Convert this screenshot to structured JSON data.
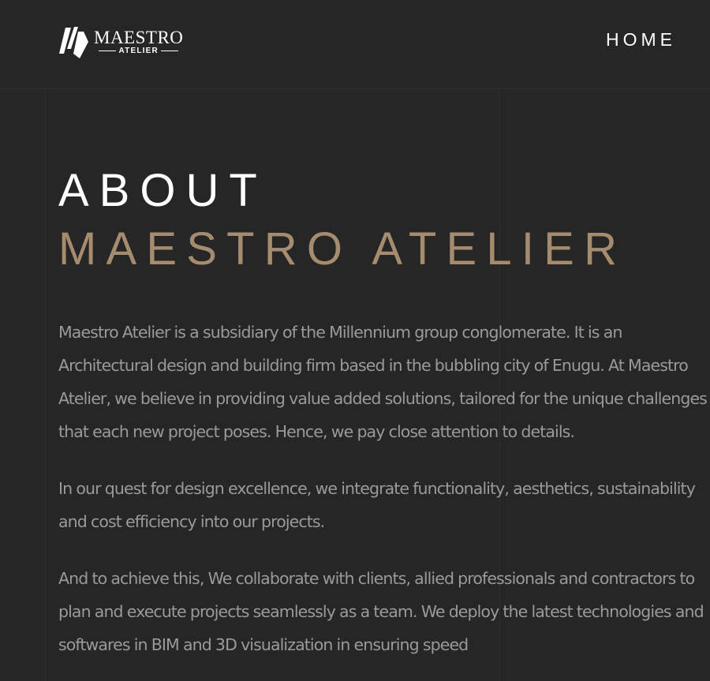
{
  "header": {
    "logo": {
      "main": "MAESTRO",
      "sub": "ATELIER",
      "mark_icon": "maestro-atelier-logo-mark"
    },
    "nav": {
      "home": "HOME"
    }
  },
  "hero": {
    "line1": "ABOUT",
    "line2": "MAESTRO ATELIER"
  },
  "content": {
    "paragraphs": [
      "Maestro Atelier is a subsidiary of the  Millennium group conglomerate.  It is an Architectural design and building firm based in the bubbling city of  Enugu. At Maestro Atelier, we believe in providing value added solutions, tailored for the unique challenges that each new project poses.  Hence, we pay close attention to details.",
      "In our quest for design excellence, we integrate functionality, aesthetics, sustainability and cost efficiency into our projects.",
      "And to achieve this, We collaborate with clients, allied professionals and contractors to plan and execute projects seamlessly as a team. We deploy the latest technologies and softwares in  BIM and 3D visualization in ensuring speed"
    ]
  },
  "colors": {
    "background": "#262626",
    "accent": "#a68c6e",
    "body_text": "#9a9a9a",
    "heading": "#ffffff"
  }
}
